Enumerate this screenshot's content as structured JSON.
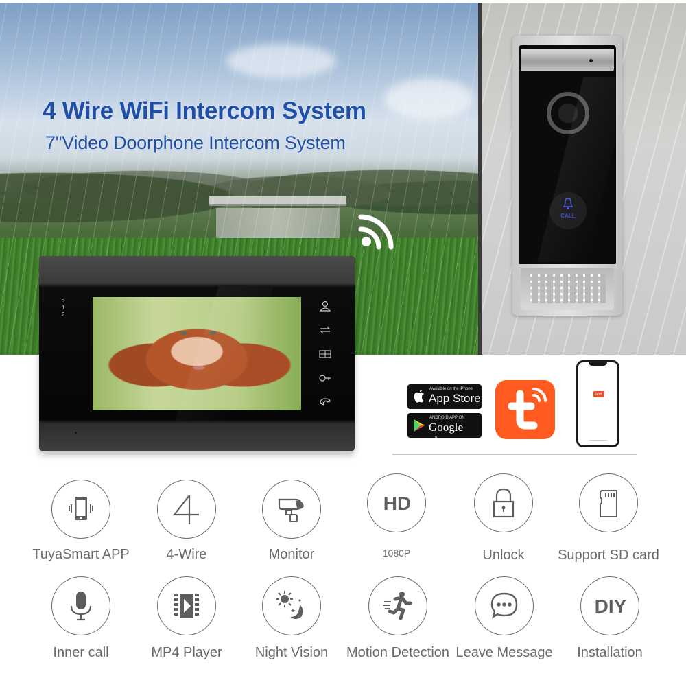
{
  "headline": {
    "title": "4 Wire WiFi Intercom System",
    "subtitle": "7\"Video Doorphone Intercom System"
  },
  "door_station": {
    "call_label": "CALL"
  },
  "monitor": {
    "led_labels": [
      "1",
      "2"
    ],
    "side_buttons": [
      "user-icon",
      "transfer-icon",
      "gate-icon",
      "key-unlock-icon",
      "handset-icon"
    ]
  },
  "app_badges": {
    "app_store": {
      "small": "Available on the iPhone",
      "big": "App Store"
    },
    "google_play": {
      "small": "ANDROID APP ON",
      "big": "Google play"
    },
    "tuya_logo": "tuya-logo",
    "phone_app_label": "tuya"
  },
  "colors": {
    "headline_blue": "#1f4fa8",
    "tuya_orange": "#ff5a1f",
    "feature_gray": "#6a6a6a"
  },
  "features": [
    {
      "icon": "vibrating-phone-icon",
      "label": "TuyaSmart APP"
    },
    {
      "icon": "number-four-icon",
      "label": "4-Wire",
      "glyph": "4"
    },
    {
      "icon": "cctv-camera-icon",
      "label": "Monitor"
    },
    {
      "icon": "hd-icon",
      "label": "1080P",
      "glyph": "HD"
    },
    {
      "icon": "padlock-icon",
      "label": "Unlock"
    },
    {
      "icon": "sd-card-icon",
      "label": "Support  SD card"
    },
    {
      "icon": "microphone-icon",
      "label": "Inner call"
    },
    {
      "icon": "film-play-icon",
      "label": "MP4 Player"
    },
    {
      "icon": "sun-moon-icon",
      "label": "Night Vision"
    },
    {
      "icon": "running-person-icon",
      "label": "Motion Detection"
    },
    {
      "icon": "chat-bubble-icon",
      "label": "Leave Message"
    },
    {
      "icon": "diy-icon",
      "label": "Installation",
      "glyph": "DIY"
    }
  ]
}
